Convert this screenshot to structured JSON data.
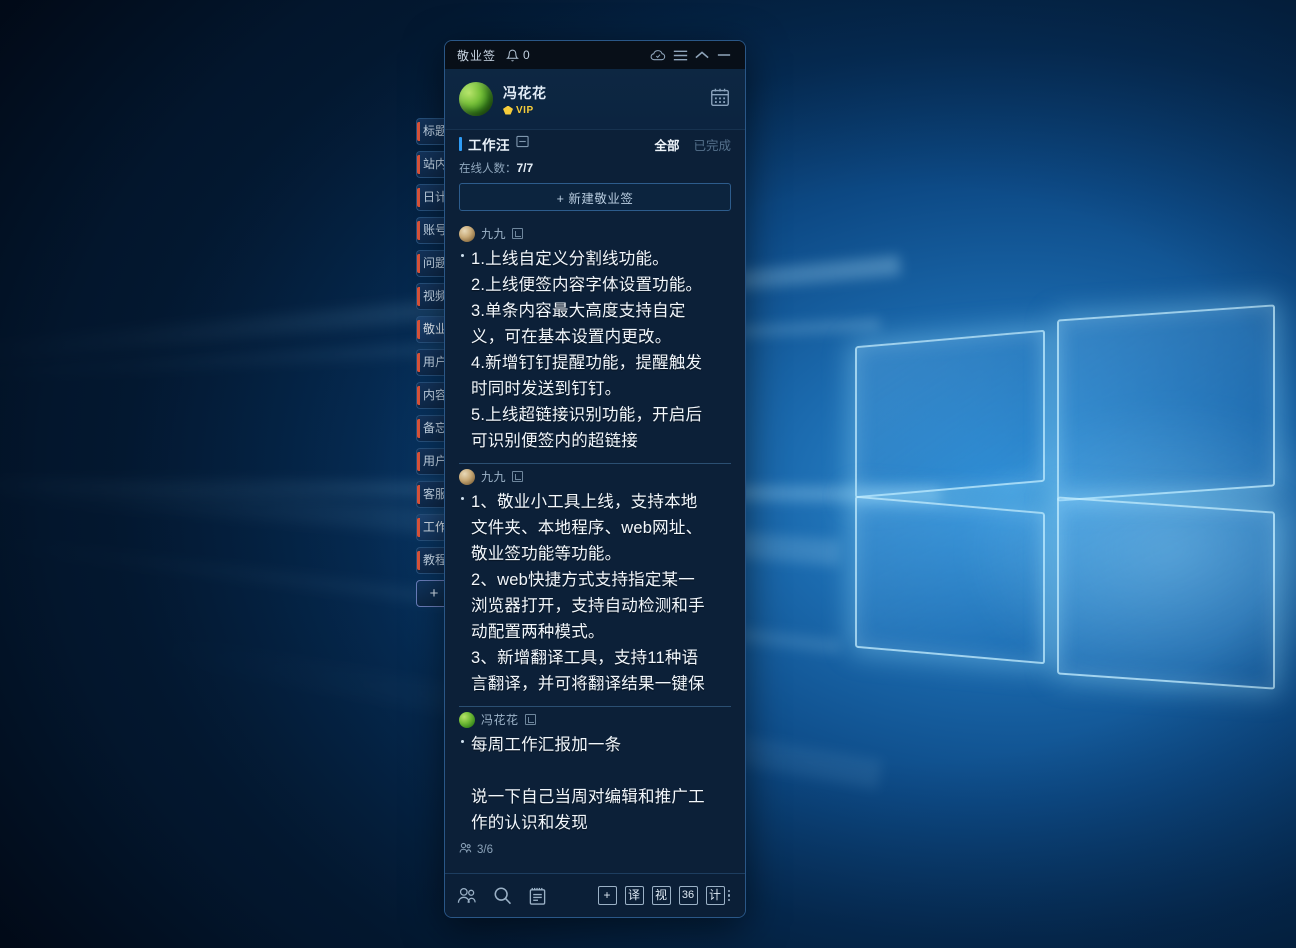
{
  "window": {
    "title": "敬业签",
    "bell_icon": "bell-icon",
    "notification_count": "0",
    "controls": [
      {
        "name": "cloud-sync-icon",
        "label": "云同步"
      },
      {
        "name": "menu-icon",
        "label": "菜单"
      },
      {
        "name": "collapse-icon",
        "label": "收起"
      },
      {
        "name": "minimize-icon",
        "label": "最小化"
      }
    ]
  },
  "profile": {
    "avatar": "user-avatar",
    "name": "冯花花",
    "vip_badge": "VIP",
    "gem_icon": "diamond-icon",
    "calendar_icon": "calendar-icon"
  },
  "group": {
    "name": "工作汪",
    "list_icon": "list-icon",
    "filter_all": "全部",
    "filter_done": "已完成",
    "online_label": "在线人数：",
    "online_count": "7/7",
    "new_note_label": "+ 新建敬业签"
  },
  "notes": [
    {
      "author": "九九",
      "avatar": "note-avatar-jiujiu",
      "badge_icon": "note-type-icon",
      "content": "1.上线自定义分割线功能。\n2.上线便签内容字体设置功能。\n3.单条内容最大高度支持自定\n义，可在基本设置内更改。\n4.新增钉钉提醒功能，提醒触发\n时同时发送到钉钉。\n5.上线超链接识别功能，开启后\n可识别便签内的超链接"
    },
    {
      "author": "九九",
      "avatar": "note-avatar-jiujiu",
      "badge_icon": "note-type-icon",
      "content": "1、敬业小工具上线，支持本地\n文件夹、本地程序、web网址、\n敬业签功能等功能。\n2、web快捷方式支持指定某一\n浏览器打开，支持自动检测和手\n动配置两种模式。\n3、新增翻译工具，支持11种语\n言翻译，并可将翻译结果一键保"
    },
    {
      "author": "冯花花",
      "avatar": "note-avatar-fenghuahua",
      "badge_icon": "note-type-icon",
      "content": "每周工作汇报加一条\n\n说一下自己当周对编辑和推广工\n作的认识和发现",
      "meta_icon": "people-icon",
      "meta_text": "3/6"
    }
  ],
  "toolbar": {
    "left": [
      {
        "name": "contacts-icon",
        "label": "联系人"
      },
      {
        "name": "search-icon",
        "label": "搜索"
      },
      {
        "name": "note-list-icon",
        "label": "便签列表"
      }
    ],
    "right": [
      {
        "name": "add-button",
        "label": "+"
      },
      {
        "name": "translate-button",
        "label": "译"
      },
      {
        "name": "video-button",
        "label": "视"
      },
      {
        "name": "count-36-button",
        "label": "36"
      },
      {
        "name": "calculator-button",
        "label": "计"
      }
    ],
    "more_icon": "more-vertical-icon"
  },
  "sidebar_tabs": [
    {
      "label": "标题",
      "active": false
    },
    {
      "label": "站内",
      "active": false
    },
    {
      "label": "日计",
      "active": false
    },
    {
      "label": "账号",
      "active": false
    },
    {
      "label": "问题",
      "active": false
    },
    {
      "label": "视频",
      "active": false
    },
    {
      "label": "敬业",
      "active": true
    },
    {
      "label": "用户",
      "active": false
    },
    {
      "label": "内容",
      "active": false
    },
    {
      "label": "备忘",
      "active": false
    },
    {
      "label": "用户",
      "active": false
    },
    {
      "label": "客服",
      "active": false
    },
    {
      "label": "工作",
      "active": true
    },
    {
      "label": "教程",
      "active": false
    },
    {
      "label": "+",
      "active": false,
      "is_add": true
    }
  ],
  "colors": {
    "accent_blue": "#2f9cf5",
    "vip_gold": "#f6cd3b",
    "tab_accent": "#e0563c",
    "window_bg": "#0c2038",
    "titlebar_bg": "#080f18"
  }
}
